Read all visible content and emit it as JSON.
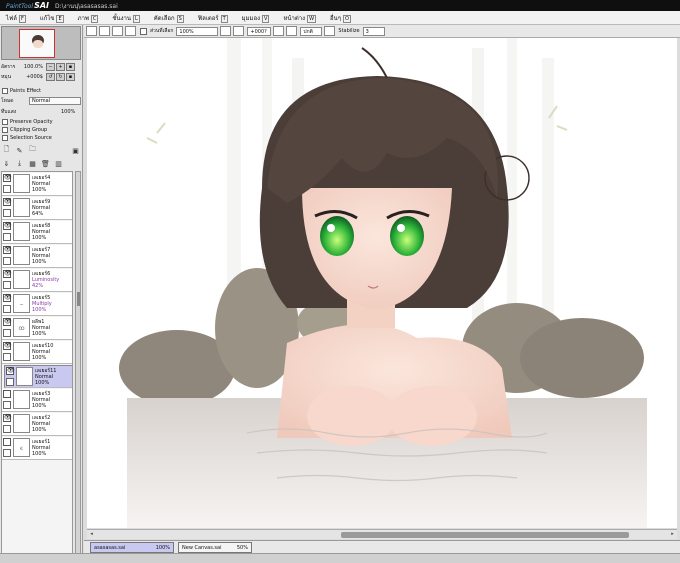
{
  "window": {
    "app_small": "PaintTool",
    "app_big": "SAI",
    "path": "D:\\งานนุ่\\asasasas.sai"
  },
  "menu": [
    {
      "label": "ไฟล์",
      "key": "F"
    },
    {
      "label": "แก้ไข",
      "key": "E"
    },
    {
      "label": "ภาพ",
      "key": "C"
    },
    {
      "label": "ชั้นงาน",
      "key": "L"
    },
    {
      "label": "คัดเลือก",
      "key": "S"
    },
    {
      "label": "ฟิลเตอร์",
      "key": "T"
    },
    {
      "label": "มุมมอง",
      "key": "V"
    },
    {
      "label": "หน้าต่าง",
      "key": "W"
    },
    {
      "label": "อื่นๆ",
      "key": "O"
    }
  ],
  "navigator": {
    "zoom_label": "อัตราขยาย",
    "zoom_value": "100.0%",
    "rotate_label": "หมุน",
    "rotate_value": "+000$"
  },
  "paints_effect": "Paints Effect",
  "blend": {
    "label": "โหมด",
    "value": "Normal"
  },
  "opacity": {
    "label": "ทึบแสง",
    "value": "100%"
  },
  "options": {
    "preserve": "Preserve Opacity",
    "clipping": "Clipping Group",
    "selection": "Selection Source"
  },
  "layer_tools": {
    "new": "🗋",
    "folder": "🗀",
    "delete": "🗑"
  },
  "layers": [
    {
      "name": "เลเยอร์4",
      "mode": "Normal",
      "opacity": "100%",
      "purple": false,
      "visible": true,
      "selected": false,
      "thumb": ""
    },
    {
      "name": "เลเยอร์9",
      "mode": "Normal",
      "opacity": "64%",
      "purple": false,
      "visible": true,
      "selected": false,
      "thumb": ""
    },
    {
      "name": "เลเยอร์8",
      "mode": "Normal",
      "opacity": "100%",
      "purple": false,
      "visible": true,
      "selected": false,
      "thumb": ""
    },
    {
      "name": "เลเยอร์7",
      "mode": "Normal",
      "opacity": "100%",
      "purple": false,
      "visible": true,
      "selected": false,
      "thumb": ""
    },
    {
      "name": "เลเยอร์6",
      "mode": "Luminosity",
      "opacity": "42%",
      "purple": true,
      "visible": true,
      "selected": false,
      "thumb": ""
    },
    {
      "name": "เลเยอร์5",
      "mode": "Multiply",
      "opacity": "100%",
      "purple": true,
      "visible": true,
      "selected": false,
      "thumb": "⌣"
    },
    {
      "name": "ผลีพ1",
      "mode": "Normal",
      "opacity": "100%",
      "purple": false,
      "visible": true,
      "selected": false,
      "thumb": "ꝏ"
    },
    {
      "name": "เลเยอร์10",
      "mode": "Normal",
      "opacity": "100%",
      "purple": false,
      "visible": true,
      "selected": false,
      "thumb": ""
    },
    {
      "name": "เลเยอร์11",
      "mode": "Normal",
      "opacity": "100%",
      "purple": false,
      "visible": true,
      "selected": true,
      "thumb": ""
    },
    {
      "name": "เลเยอร์3",
      "mode": "Normal",
      "opacity": "100%",
      "purple": false,
      "visible": false,
      "selected": false,
      "thumb": ""
    },
    {
      "name": "เลเยอร์2",
      "mode": "Normal",
      "opacity": "100%",
      "purple": false,
      "visible": true,
      "selected": false,
      "thumb": ""
    },
    {
      "name": "เลเยอร์1",
      "mode": "Normal",
      "opacity": "100%",
      "purple": false,
      "visible": false,
      "selected": false,
      "thumb": "ꞓ"
    }
  ],
  "toolbar": {
    "selection_label": "ส่วนที่เลือก",
    "zoom": "100%",
    "angle": "+000?",
    "mode": "ปกติ",
    "stabilize_label": "Stabilize",
    "stabilize_value": "3"
  },
  "documents": [
    {
      "name": "asasasas.sai",
      "zoom": "100%",
      "active": true
    },
    {
      "name": "New Canvas.sai",
      "zoom": "50%",
      "active": false
    }
  ],
  "colors": {
    "selected_layer": "#c8c8f0",
    "active_doc": "#c8c8f0",
    "purple_text": "#8a3aa8"
  }
}
